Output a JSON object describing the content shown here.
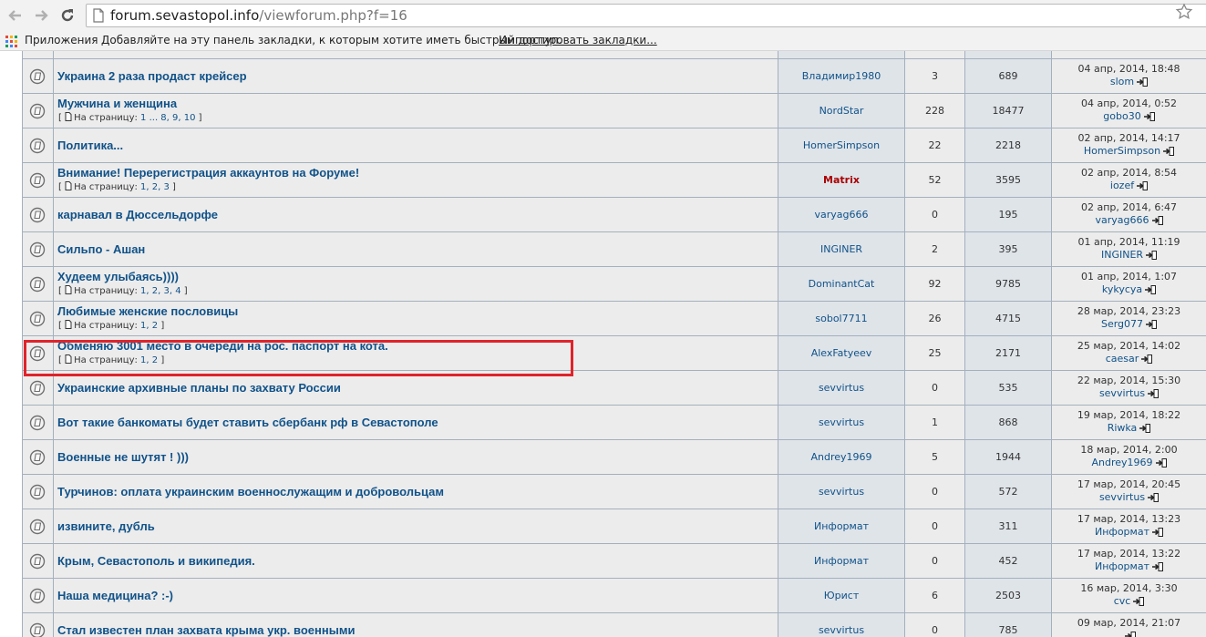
{
  "browser": {
    "url_domain": "forum.sevastopol.info",
    "url_path": "/viewforum.php?f=16",
    "apps_label": "Приложения",
    "bookmarks_hint": "Добавляйте на эту панель закладки, к которым хотите иметь быстрый доступ.",
    "import_link": "Импортировать закладки..."
  },
  "pages_prefix": "[",
  "pages_label": "На страницу:",
  "pages_suffix": "]",
  "topics": [
    {
      "title": "Украина 2 раза продаст крейсер",
      "pages": "",
      "author": "Владимир1980",
      "admin": false,
      "replies": "3",
      "views": "689",
      "last_date": "04 апр, 2014, 18:48",
      "last_user": "slom"
    },
    {
      "title": "Мужчина и женщина",
      "pages": "1 ... 8, 9, 10",
      "author": "NordStar",
      "admin": false,
      "replies": "228",
      "views": "18477",
      "last_date": "04 апр, 2014, 0:52",
      "last_user": "gobo30"
    },
    {
      "title": "Политика...",
      "pages": "",
      "author": "HomerSimpson",
      "admin": false,
      "replies": "22",
      "views": "2218",
      "last_date": "02 апр, 2014, 14:17",
      "last_user": "HomerSimpson"
    },
    {
      "title": "Внимание! Перерегистрация аккаунтов на Форуме!",
      "pages": "1, 2, 3",
      "author": "Matrix",
      "admin": true,
      "replies": "52",
      "views": "3595",
      "last_date": "02 апр, 2014, 8:54",
      "last_user": "iozef"
    },
    {
      "title": "карнавал в Дюссельдорфе",
      "pages": "",
      "author": "varyag666",
      "admin": false,
      "replies": "0",
      "views": "195",
      "last_date": "02 апр, 2014, 6:47",
      "last_user": "varyag666"
    },
    {
      "title": "Сильпо - Ашан",
      "pages": "",
      "author": "INGINER",
      "admin": false,
      "replies": "2",
      "views": "395",
      "last_date": "01 апр, 2014, 11:19",
      "last_user": "INGINER"
    },
    {
      "title": "Худеем улыбаясь))))",
      "pages": "1, 2, 3, 4",
      "author": "DominantCat",
      "admin": false,
      "replies": "92",
      "views": "9785",
      "last_date": "01 апр, 2014, 1:07",
      "last_user": "kykycya"
    },
    {
      "title": "Любимые женские пословицы",
      "pages": "1, 2",
      "author": "sobol7711",
      "admin": false,
      "replies": "26",
      "views": "4715",
      "last_date": "28 мар, 2014, 23:23",
      "last_user": "Serg077"
    },
    {
      "title": "Обменяю 3001 место в очереди на рос. паспорт на кота.",
      "pages": "1, 2",
      "author": "AlexFatyeev",
      "admin": false,
      "replies": "25",
      "views": "2171",
      "last_date": "25 мар, 2014, 14:02",
      "last_user": "caesar"
    },
    {
      "title": "Украинские архивные планы по захвату России",
      "pages": "",
      "author": "sevvirtus",
      "admin": false,
      "replies": "0",
      "views": "535",
      "last_date": "22 мар, 2014, 15:30",
      "last_user": "sevvirtus"
    },
    {
      "title": "Вот такие банкоматы будет ставить сбербанк рф в Севастополе",
      "pages": "",
      "author": "sevvirtus",
      "admin": false,
      "replies": "1",
      "views": "868",
      "last_date": "19 мар, 2014, 18:22",
      "last_user": "Riwka"
    },
    {
      "title": "Военные не шутят ! )))",
      "pages": "",
      "author": "Andrey1969",
      "admin": false,
      "replies": "5",
      "views": "1944",
      "last_date": "18 мар, 2014, 2:00",
      "last_user": "Andrey1969"
    },
    {
      "title": "Турчинов: оплата украинским военнослужащим и добровольцам",
      "pages": "",
      "author": "sevvirtus",
      "admin": false,
      "replies": "0",
      "views": "572",
      "last_date": "17 мар, 2014, 20:45",
      "last_user": "sevvirtus"
    },
    {
      "title": "извините, дубль",
      "pages": "",
      "author": "Информат",
      "admin": false,
      "replies": "0",
      "views": "311",
      "last_date": "17 мар, 2014, 13:23",
      "last_user": "Информат"
    },
    {
      "title": "Крым, Севастополь и википедия.",
      "pages": "",
      "author": "Информат",
      "admin": false,
      "replies": "0",
      "views": "452",
      "last_date": "17 мар, 2014, 13:22",
      "last_user": "Информат"
    },
    {
      "title": "Наша медицина? :-)",
      "pages": "",
      "author": "Юрист",
      "admin": false,
      "replies": "6",
      "views": "2503",
      "last_date": "16 мар, 2014, 3:30",
      "last_user": "cvc"
    },
    {
      "title": "Стал известен план захвата крыма укр. военными",
      "pages": "",
      "author": "sevvirtus",
      "admin": false,
      "replies": "0",
      "views": "785",
      "last_date": "09 мар, 2014, 21:07",
      "last_user": ""
    }
  ],
  "colors": {
    "link": "#105289",
    "admin": "#aa0000",
    "highlight": "#e0232b"
  }
}
